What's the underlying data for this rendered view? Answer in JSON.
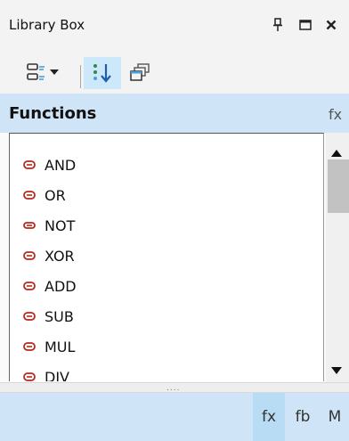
{
  "window": {
    "title": "Library Box",
    "pin_icon": "pin-icon",
    "maximize_icon": "maximize-icon",
    "close_icon": "close-icon"
  },
  "toolbar": {
    "view_options_icon": "list-view-dropdown-icon",
    "sort_icon": "sort-icon",
    "collapse_icon": "stacked-windows-icon"
  },
  "section": {
    "title": "Functions",
    "icon_label": "fx"
  },
  "items": [
    {
      "label": "AND",
      "icon": "function-block-icon"
    },
    {
      "label": "OR",
      "icon": "function-block-icon"
    },
    {
      "label": "NOT",
      "icon": "inverter-icon"
    },
    {
      "label": "XOR",
      "icon": "function-block-icon"
    },
    {
      "label": "ADD",
      "icon": "function-block-icon"
    },
    {
      "label": "SUB",
      "icon": "function-block-icon"
    },
    {
      "label": "MUL",
      "icon": "function-block-icon"
    },
    {
      "label": "DIV",
      "icon": "function-block-icon"
    }
  ],
  "splitter_grip": "....",
  "bottom_tabs": [
    {
      "label": "fx",
      "active": true
    },
    {
      "label": "fb",
      "active": false
    },
    {
      "label": "M",
      "active": false
    }
  ],
  "colors": {
    "accent": "#cfe5f7",
    "icon_red": "#b5281c"
  }
}
